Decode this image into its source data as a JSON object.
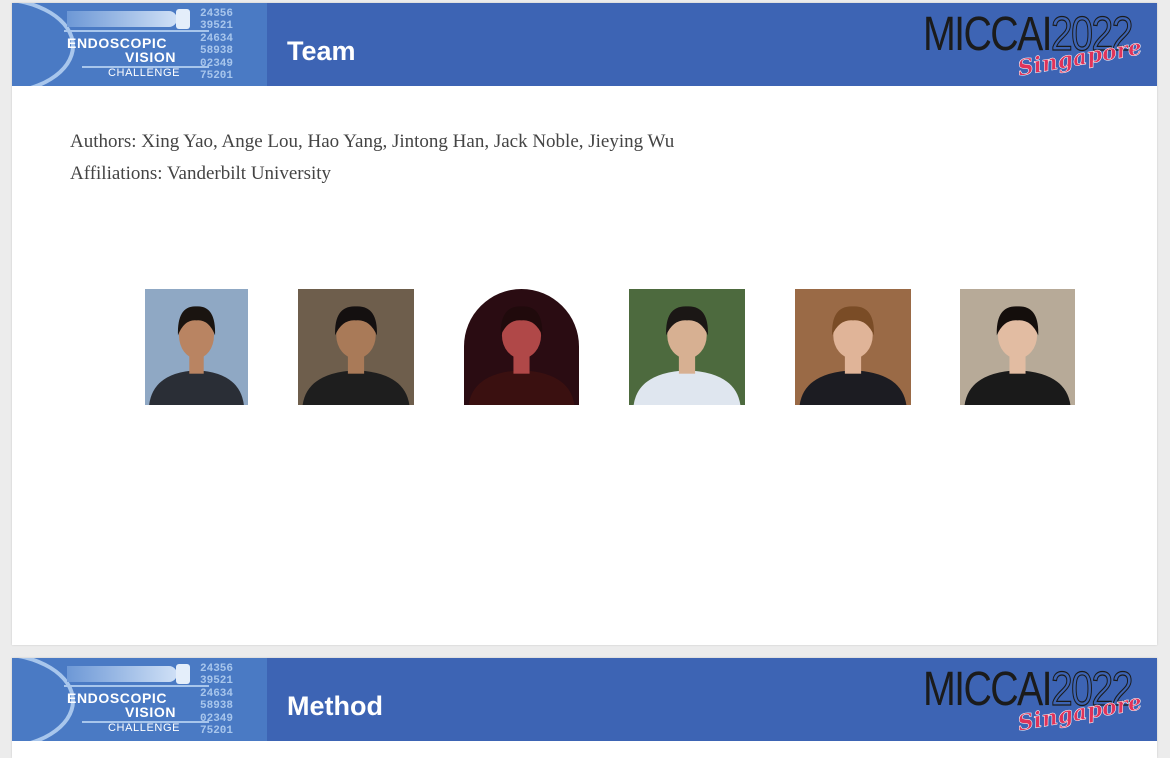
{
  "slides": [
    {
      "banner": {
        "logo": {
          "line1": "ENDOSCOPIC",
          "line2": "VISION",
          "line3": "CHALLENGE",
          "digits": [
            "24356",
            "39521",
            "24634",
            "58938",
            "02349",
            "75201"
          ]
        },
        "title": "Team",
        "conference": {
          "name": "MICCAI",
          "year": "2022",
          "city": "Singapore"
        }
      },
      "authors": "Authors: Xing Yao, Ange Lou, Hao Yang, Jintong Han, Jack Noble, Jieying Wu",
      "affiliations": "Affiliations: Vanderbilt University",
      "photos": [
        {
          "icon": "person-photo",
          "background": "#8fa8c4",
          "shirt": "#2a2e36",
          "skin": "#b98462",
          "hair": "#1a1410"
        },
        {
          "icon": "person-photo",
          "background": "#6e5e4c",
          "shirt": "#1e1e1e",
          "skin": "#a97a58",
          "hair": "#141010"
        },
        {
          "icon": "person-photo",
          "background": "#2a0c12",
          "shirt": "#3a1010",
          "skin": "#b04848",
          "hair": "#200a0c"
        },
        {
          "icon": "person-photo",
          "background": "#4d6a3e",
          "shirt": "#dfe6ef",
          "skin": "#d7b092",
          "hair": "#1b1715"
        },
        {
          "icon": "person-photo",
          "background": "#9a6a46",
          "shirt": "#1c1c22",
          "skin": "#e0b498",
          "hair": "#7a4c26"
        },
        {
          "icon": "person-photo",
          "background": "#b7aa98",
          "shirt": "#1a1a1a",
          "skin": "#e2bca2",
          "hair": "#140e0c"
        }
      ]
    },
    {
      "banner": {
        "logo": {
          "line1": "ENDOSCOPIC",
          "line2": "VISION",
          "line3": "CHALLENGE",
          "digits": [
            "24356",
            "39521",
            "24634",
            "58938",
            "02349",
            "75201"
          ]
        },
        "title": "Method",
        "conference": {
          "name": "MICCAI",
          "year": "2022",
          "city": "Singapore"
        }
      }
    }
  ]
}
